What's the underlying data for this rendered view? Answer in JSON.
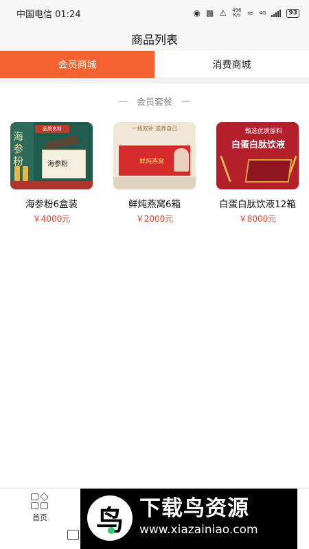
{
  "status_bar": {
    "carrier_time": "中国电信 01:24",
    "net_speed_value": "496",
    "net_speed_unit": "K/s",
    "network_type": "4G",
    "battery": "93"
  },
  "header": {
    "title": "商品列表"
  },
  "tabs": [
    {
      "label": "会员商城",
      "active": true
    },
    {
      "label": "消费商城",
      "active": false
    }
  ],
  "section": {
    "title": "会员套餐"
  },
  "products": [
    {
      "name": "海参粉6盒装",
      "price": "￥4000元",
      "image_texts": {
        "left": "海参粉",
        "banner": "品质良材",
        "box": "海参粉"
      }
    },
    {
      "name": "鲜炖燕窝6箱",
      "price": "￥2000元",
      "image_texts": {
        "slogan": "一瓶双补 滋养自己",
        "box": "鲜炖燕窝"
      }
    },
    {
      "name": "白蛋白肽饮液12箱",
      "price": "￥8000元",
      "image_texts": {
        "tag": "甄选优质原料",
        "title": "白蛋白肽饮液"
      }
    }
  ],
  "bottom_nav": {
    "home_label": "首页"
  },
  "watermark": {
    "logo_char": "鸟",
    "title": "下载鸟资源",
    "url": "www.xiazainiao.com"
  },
  "colors": {
    "accent": "#f4622f",
    "price": "#e8452c"
  }
}
